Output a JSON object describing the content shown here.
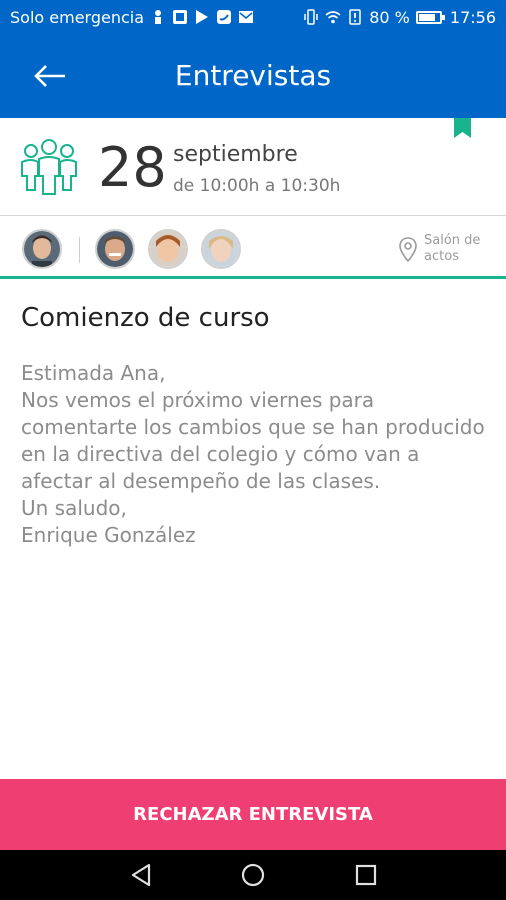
{
  "status_bar": {
    "carrier": "Solo emergencia",
    "battery": "80 %",
    "battery_level": 0.8,
    "time": "17:56"
  },
  "app_bar": {
    "title": "Entrevistas",
    "back_icon": "arrow-left-icon"
  },
  "event": {
    "day": "28",
    "month": "septiembre",
    "time_range": "de 10:00h a 10:30h",
    "location": "Salón de actos",
    "accent_color": "#19b48e",
    "bookmark_color": "#19b48e"
  },
  "participants": [
    {
      "name": "organizer"
    },
    {
      "name": "attendee-1"
    },
    {
      "name": "attendee-2"
    },
    {
      "name": "attendee-3"
    }
  ],
  "message": {
    "subject": "Comienzo de curso",
    "body": "Estimada Ana,\nNos vemos el próximo viernes para comentarte los cambios que se han producido en la directiva del colegio y cómo van a afectar al desempeño de las clases.\nUn saludo,\nEnrique González"
  },
  "actions": {
    "reject_label": "RECHAZAR ENTREVISTA",
    "reject_color": "#ef3f72"
  },
  "colors": {
    "primary": "#0066c8",
    "accent": "#19b48e"
  }
}
